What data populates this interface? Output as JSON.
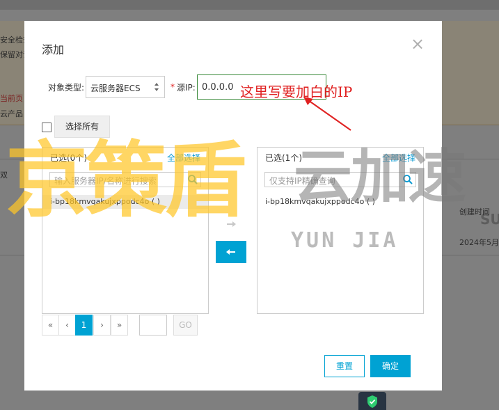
{
  "background": {
    "warning_lines": [
      "安全检查",
      "保留对话"
    ],
    "red_line": "当前页",
    "products_line": "云产品",
    "filter_label": "双",
    "created_time_header": "创建时间",
    "created_time_value": "2024年5月"
  },
  "modal": {
    "title": "添加",
    "close_label": "×",
    "object_type_label": "对象类型:",
    "object_type_value": "云服务器ECS",
    "required_mark": "*",
    "source_ip_label": "源IP:",
    "source_ip_value": "0.0.0.0",
    "annotation": "这里写要加白的IP",
    "select_all_label": "选择所有",
    "left_panel": {
      "title": "已选(0个)",
      "select_all": "全部选择",
      "search_placeholder": "输入服务器IP/名称进行搜索",
      "items": [
        "i-bp18kmvqakujxppodc4o ( )"
      ]
    },
    "right_panel": {
      "title": "已选(1个)",
      "select_all": "全部选择",
      "search_placeholder": "仅支持IP精确查询",
      "items": [
        "i-bp18kmvqakujxppodc4o ( )"
      ]
    },
    "pager": {
      "first": "«",
      "prev": "‹",
      "current": "1",
      "next": "›",
      "last": "»",
      "go": "GO"
    },
    "reset_label": "重置",
    "ok_label": "确定"
  },
  "watermark": {
    "left": "京策盾",
    "right": "云加速",
    "sub": "YUN JIA",
    "su": "SU"
  },
  "colors": {
    "accent": "#00a2d3",
    "annotation": "#e02020",
    "watermark_yellow": "#ffc628"
  }
}
